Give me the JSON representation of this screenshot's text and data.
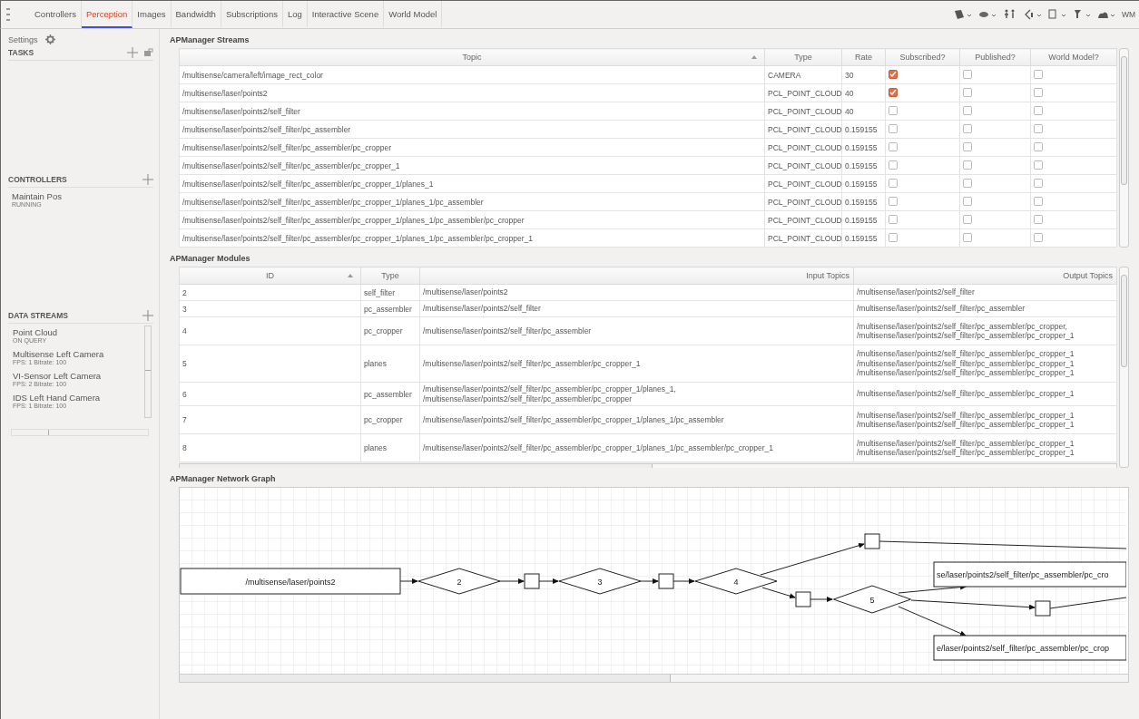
{
  "tabs": [
    {
      "label": "Controllers",
      "selected": false
    },
    {
      "label": "Perception",
      "selected": true
    },
    {
      "label": "Images",
      "selected": false
    },
    {
      "label": "Bandwidth",
      "selected": false
    },
    {
      "label": "Subscriptions",
      "selected": false
    },
    {
      "label": "Log",
      "selected": false
    },
    {
      "label": "Interactive Scene",
      "selected": false
    },
    {
      "label": "World Model",
      "selected": false
    }
  ],
  "toolbar": {
    "wm_label": "WM"
  },
  "sidebar": {
    "settings_label": "Settings",
    "sections": [
      {
        "kind": "tasks",
        "title": "TASKS"
      },
      {
        "kind": "controllers",
        "title": "CONTROLLERS",
        "items": [
          {
            "name": "Maintain Pos",
            "detail": "RUNNING"
          }
        ]
      },
      {
        "kind": "streams",
        "title": "DATA STREAMS",
        "items": [
          {
            "name": "Point Cloud",
            "detail": "ON QUERY"
          },
          {
            "name": "Multisense Left Camera",
            "detail": "FPS: 1 Bitrate: 100"
          },
          {
            "name": "VI-Sensor Left Camera",
            "detail": "FPS: 2 Bitrate: 100"
          },
          {
            "name": "IDS Left Hand Camera",
            "detail": "FPS: 1 Bitrate: 100"
          }
        ]
      }
    ]
  },
  "streams": {
    "title": "APManager Streams",
    "columns": [
      "Topic",
      "Type",
      "Rate",
      "Subscribed?",
      "Published?",
      "World Model?"
    ],
    "rows": [
      {
        "topic": "/multisense/camera/left/image_rect_color",
        "type": "CAMERA",
        "rate": "30",
        "subscribed": true,
        "published": false,
        "world_model": false
      },
      {
        "topic": "/multisense/laser/points2",
        "type": "PCL_POINT_CLOUD",
        "rate": "40",
        "subscribed": true,
        "published": false,
        "world_model": false
      },
      {
        "topic": "/multisense/laser/points2/self_filter",
        "type": "PCL_POINT_CLOUD",
        "rate": "40",
        "subscribed": false,
        "published": false,
        "world_model": false
      },
      {
        "topic": "/multisense/laser/points2/self_filter/pc_assembler",
        "type": "PCL_POINT_CLOUD",
        "rate": "0.159155",
        "subscribed": false,
        "published": false,
        "world_model": false
      },
      {
        "topic": "/multisense/laser/points2/self_filter/pc_assembler/pc_cropper",
        "type": "PCL_POINT_CLOUD",
        "rate": "0.159155",
        "subscribed": false,
        "published": false,
        "world_model": false
      },
      {
        "topic": "/multisense/laser/points2/self_filter/pc_assembler/pc_cropper_1",
        "type": "PCL_POINT_CLOUD",
        "rate": "0.159155",
        "subscribed": false,
        "published": false,
        "world_model": false
      },
      {
        "topic": "/multisense/laser/points2/self_filter/pc_assembler/pc_cropper_1/planes_1",
        "type": "PCL_POINT_CLOUD",
        "rate": "0.159155",
        "subscribed": false,
        "published": false,
        "world_model": false
      },
      {
        "topic": "/multisense/laser/points2/self_filter/pc_assembler/pc_cropper_1/planes_1/pc_assembler",
        "type": "PCL_POINT_CLOUD",
        "rate": "0.159155",
        "subscribed": false,
        "published": false,
        "world_model": false
      },
      {
        "topic": "/multisense/laser/points2/self_filter/pc_assembler/pc_cropper_1/planes_1/pc_assembler/pc_cropper",
        "type": "PCL_POINT_CLOUD",
        "rate": "0.159155",
        "subscribed": false,
        "published": false,
        "world_model": false
      },
      {
        "topic": "/multisense/laser/points2/self_filter/pc_assembler/pc_cropper_1/planes_1/pc_assembler/pc_cropper_1",
        "type": "PCL_POINT_CLOUD",
        "rate": "0.159155",
        "subscribed": false,
        "published": false,
        "world_model": false
      }
    ]
  },
  "modules": {
    "title": "APManager Modules",
    "columns": [
      "ID",
      "Type",
      "Input Topics",
      "Output Topics"
    ],
    "rows": [
      {
        "id": "2",
        "type": "self_filter",
        "inputs": [
          "/multisense/laser/points2"
        ],
        "outputs": [
          "/multisense/laser/points2/self_filter"
        ]
      },
      {
        "id": "3",
        "type": "pc_assembler",
        "inputs": [
          "/multisense/laser/points2/self_filter"
        ],
        "outputs": [
          "/multisense/laser/points2/self_filter/pc_assembler"
        ]
      },
      {
        "id": "4",
        "type": "pc_cropper",
        "inputs": [
          "/multisense/laser/points2/self_filter/pc_assembler"
        ],
        "outputs": [
          "/multisense/laser/points2/self_filter/pc_assembler/pc_cropper,",
          "/multisense/laser/points2/self_filter/pc_assembler/pc_cropper_1"
        ]
      },
      {
        "id": "5",
        "type": "planes",
        "inputs": [
          "/multisense/laser/points2/self_filter/pc_assembler/pc_cropper_1"
        ],
        "outputs": [
          "/multisense/laser/points2/self_filter/pc_assembler/pc_cropper_1",
          "/multisense/laser/points2/self_filter/pc_assembler/pc_cropper_1",
          "/multisense/laser/points2/self_filter/pc_assembler/pc_cropper_1"
        ]
      },
      {
        "id": "6",
        "type": "pc_assembler",
        "inputs": [
          "/multisense/laser/points2/self_filter/pc_assembler/pc_cropper_1/planes_1,",
          "/multisense/laser/points2/self_filter/pc_assembler/pc_cropper"
        ],
        "outputs": [
          "/multisense/laser/points2/self_filter/pc_assembler/pc_cropper_1"
        ]
      },
      {
        "id": "7",
        "type": "pc_cropper",
        "inputs": [
          "/multisense/laser/points2/self_filter/pc_assembler/pc_cropper_1/planes_1/pc_assembler"
        ],
        "outputs": [
          "/multisense/laser/points2/self_filter/pc_assembler/pc_cropper_1",
          "/multisense/laser/points2/self_filter/pc_assembler/pc_cropper_1"
        ]
      },
      {
        "id": "8",
        "type": "planes",
        "inputs": [
          "/multisense/laser/points2/self_filter/pc_assembler/pc_cropper_1/planes_1/pc_assembler/pc_cropper_1"
        ],
        "outputs": [
          "/multisense/laser/points2/self_filter/pc_assembler/pc_cropper_1",
          "/multisense/laser/points2/self_filter/pc_assembler/pc_cropper_1"
        ]
      }
    ]
  },
  "graph": {
    "title": "APManager Network Graph",
    "nodes": [
      {
        "kind": "topic",
        "label": "/multisense/laser/points2"
      },
      {
        "kind": "module",
        "label": "2"
      },
      {
        "kind": "module",
        "label": "3"
      },
      {
        "kind": "module",
        "label": "4"
      },
      {
        "kind": "module",
        "label": "5"
      },
      {
        "kind": "topic",
        "label": "se/laser/points2/self_filter/pc_assembler/pc_cro"
      },
      {
        "kind": "topic",
        "label": "e/laser/points2/self_filter/pc_assembler/pc_crop"
      }
    ]
  }
}
